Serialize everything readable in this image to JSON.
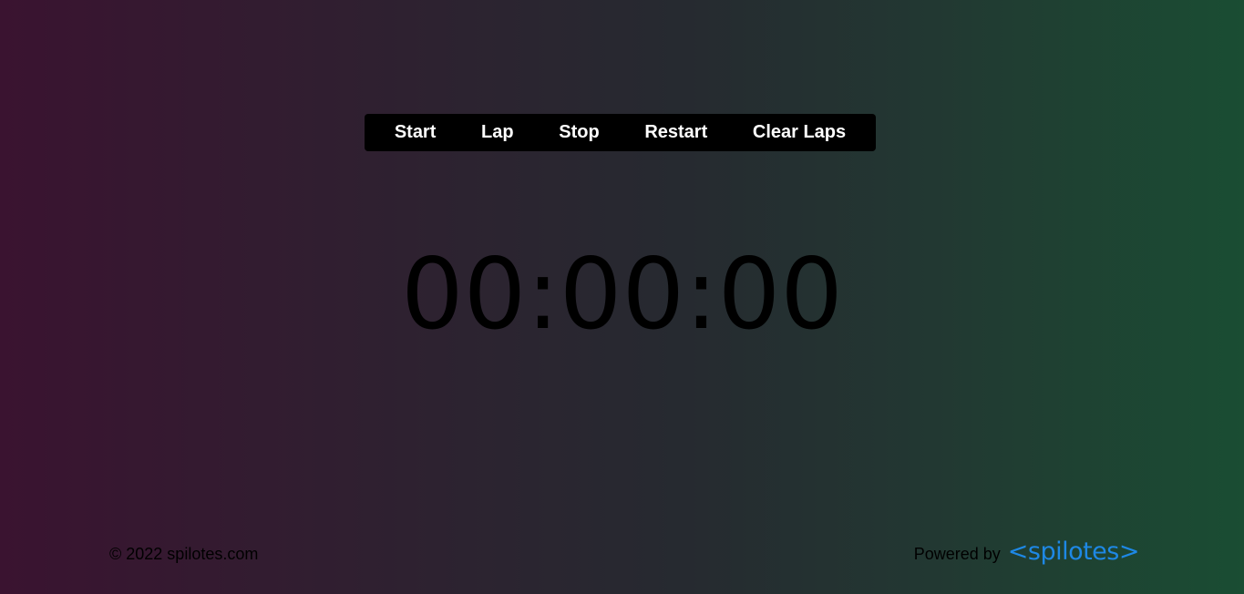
{
  "controls": {
    "start_label": "Start",
    "lap_label": "Lap",
    "stop_label": "Stop",
    "restart_label": "Restart",
    "clear_laps_label": "Clear Laps"
  },
  "timer": {
    "display": "00:00:00"
  },
  "footer": {
    "copyright": "© 2022 spilotes.com",
    "powered_by_label": "Powered by",
    "brand": "<spilotes>",
    "brand_color": "#1e88e5"
  }
}
